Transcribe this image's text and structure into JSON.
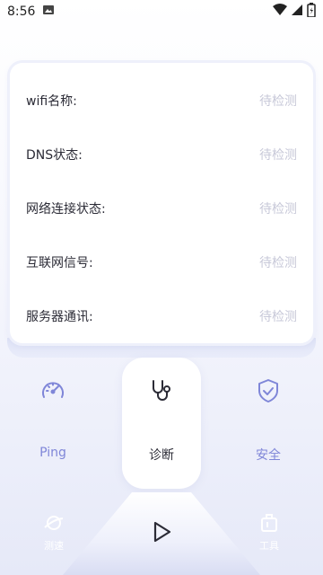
{
  "status_bar": {
    "time": "8:56",
    "icons": [
      "image-icon",
      "wifi-icon",
      "signal-icon",
      "battery-icon"
    ]
  },
  "diagnostics": {
    "rows": [
      {
        "label": "wifi名称:",
        "value": "待检测"
      },
      {
        "label": "DNS状态:",
        "value": "待检测"
      },
      {
        "label": "网络连接状态:",
        "value": "待检测"
      },
      {
        "label": "互联网信号:",
        "value": "待检测"
      },
      {
        "label": "服务器通讯:",
        "value": "待检测"
      }
    ]
  },
  "tabs": {
    "ping": {
      "label": "Ping",
      "icon": "speedometer-icon"
    },
    "diagnose": {
      "label": "诊断",
      "icon": "stethoscope-icon",
      "selected": true
    },
    "security": {
      "label": "安全",
      "icon": "shield-check-icon"
    }
  },
  "bottom_nav": {
    "speed_test": {
      "label": "测速",
      "icon": "planet-icon"
    },
    "center": {
      "icon": "play-icon"
    },
    "tools": {
      "label": "工具",
      "icon": "toolbox-icon"
    }
  },
  "colors": {
    "accent": "#7f86d8",
    "pending": "#c7c8d8",
    "text": "#2b2b36"
  }
}
